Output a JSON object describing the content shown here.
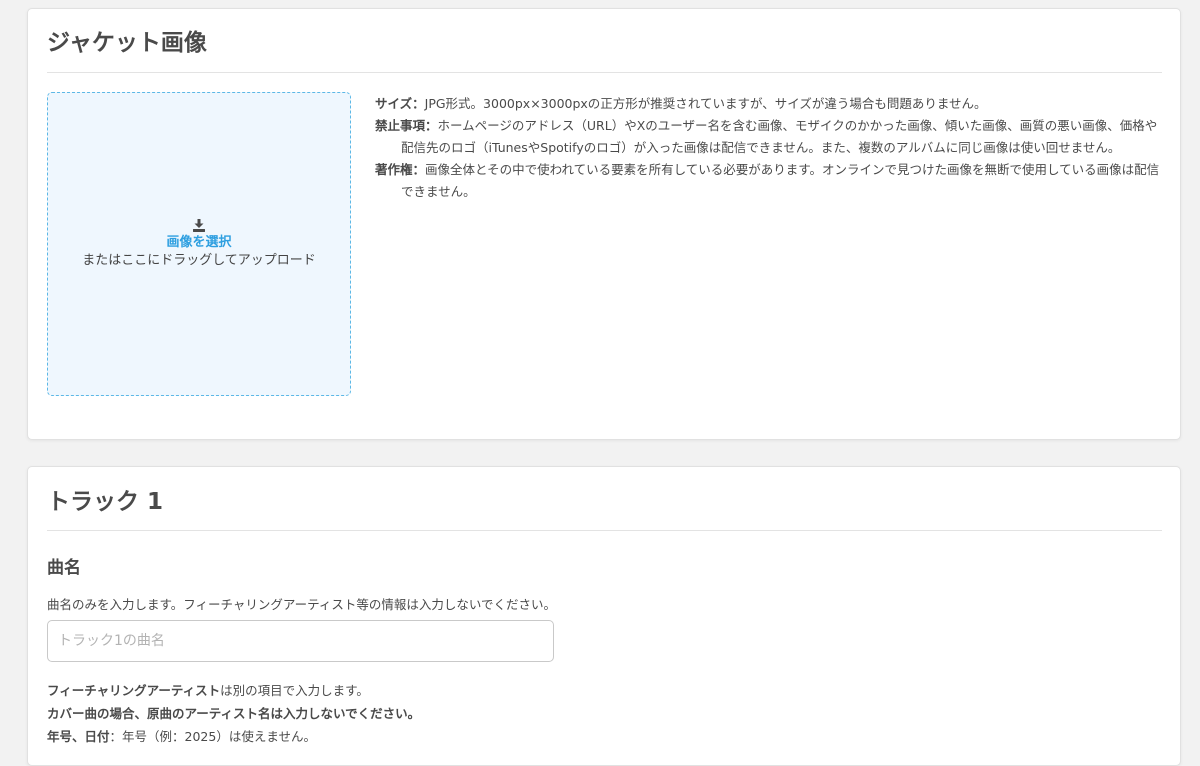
{
  "jacket": {
    "title": "ジャケット画像",
    "dropzone": {
      "icon": "download-icon",
      "select_label": "画像を選択",
      "hint": "またはここにドラッグしてアップロード"
    },
    "guidelines": [
      {
        "label": "サイズ：",
        "text": "JPG形式。3000px×3000pxの正方形が推奨されていますが、サイズが違う場合も問題ありません。"
      },
      {
        "label": "禁止事項：",
        "text": "ホームページのアドレス（URL）やXのユーザー名を含む画像、モザイクのかかった画像、傾いた画像、画質の悪い画像、価格や配信先のロゴ（iTunesやSpotifyのロゴ）が入った画像は配信できません。また、複数のアルバムに同じ画像は使い回せません。"
      },
      {
        "label": "著作権：",
        "text": "画像全体とその中で使われている要素を所有している必要があります。オンラインで見つけた画像を無断で使用している画像は配信できません。"
      }
    ]
  },
  "track": {
    "title": "トラック 1",
    "song_name": {
      "label": "曲名",
      "help": "曲名のみを入力します。フィーチャリングアーティスト等の情報は入力しないでください。",
      "value": "",
      "placeholder": "トラック1の曲名"
    },
    "notes": {
      "line1_bold": "フィーチャリングアーティスト",
      "line1_rest": "は別の項目で入力します。",
      "line2_bold": "カバー曲の場合、原曲のアーティスト名は入力しないでください。",
      "line3_bold": "年号、日付",
      "line3_rest": "：年号（例：2025）は使えません。"
    }
  },
  "colors": {
    "accent": "#2e9fe0",
    "dropzone_border": "#5cb8e6",
    "dropzone_bg": "#eff7fe",
    "text": "#4a4a4a",
    "background": "#f2f2f2"
  }
}
